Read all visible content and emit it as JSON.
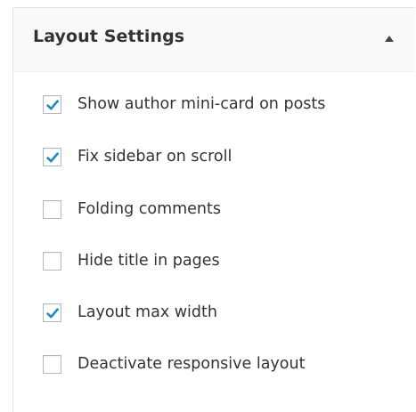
{
  "panel": {
    "title": "Layout Settings",
    "toggle_icon": "triangle-up-icon"
  },
  "options": [
    {
      "label": "Show author mini-card on posts",
      "checked": true
    },
    {
      "label": "Fix sidebar on scroll",
      "checked": true
    },
    {
      "label": "Folding comments",
      "checked": false
    },
    {
      "label": "Hide title in pages",
      "checked": false
    },
    {
      "label": "Layout max width",
      "checked": true
    },
    {
      "label": "Deactivate responsive layout",
      "checked": false
    }
  ],
  "colors": {
    "check": "#1e8cbe",
    "border": "#b4b9be",
    "header_bg": "#f9f9f9",
    "text": "#333333"
  }
}
